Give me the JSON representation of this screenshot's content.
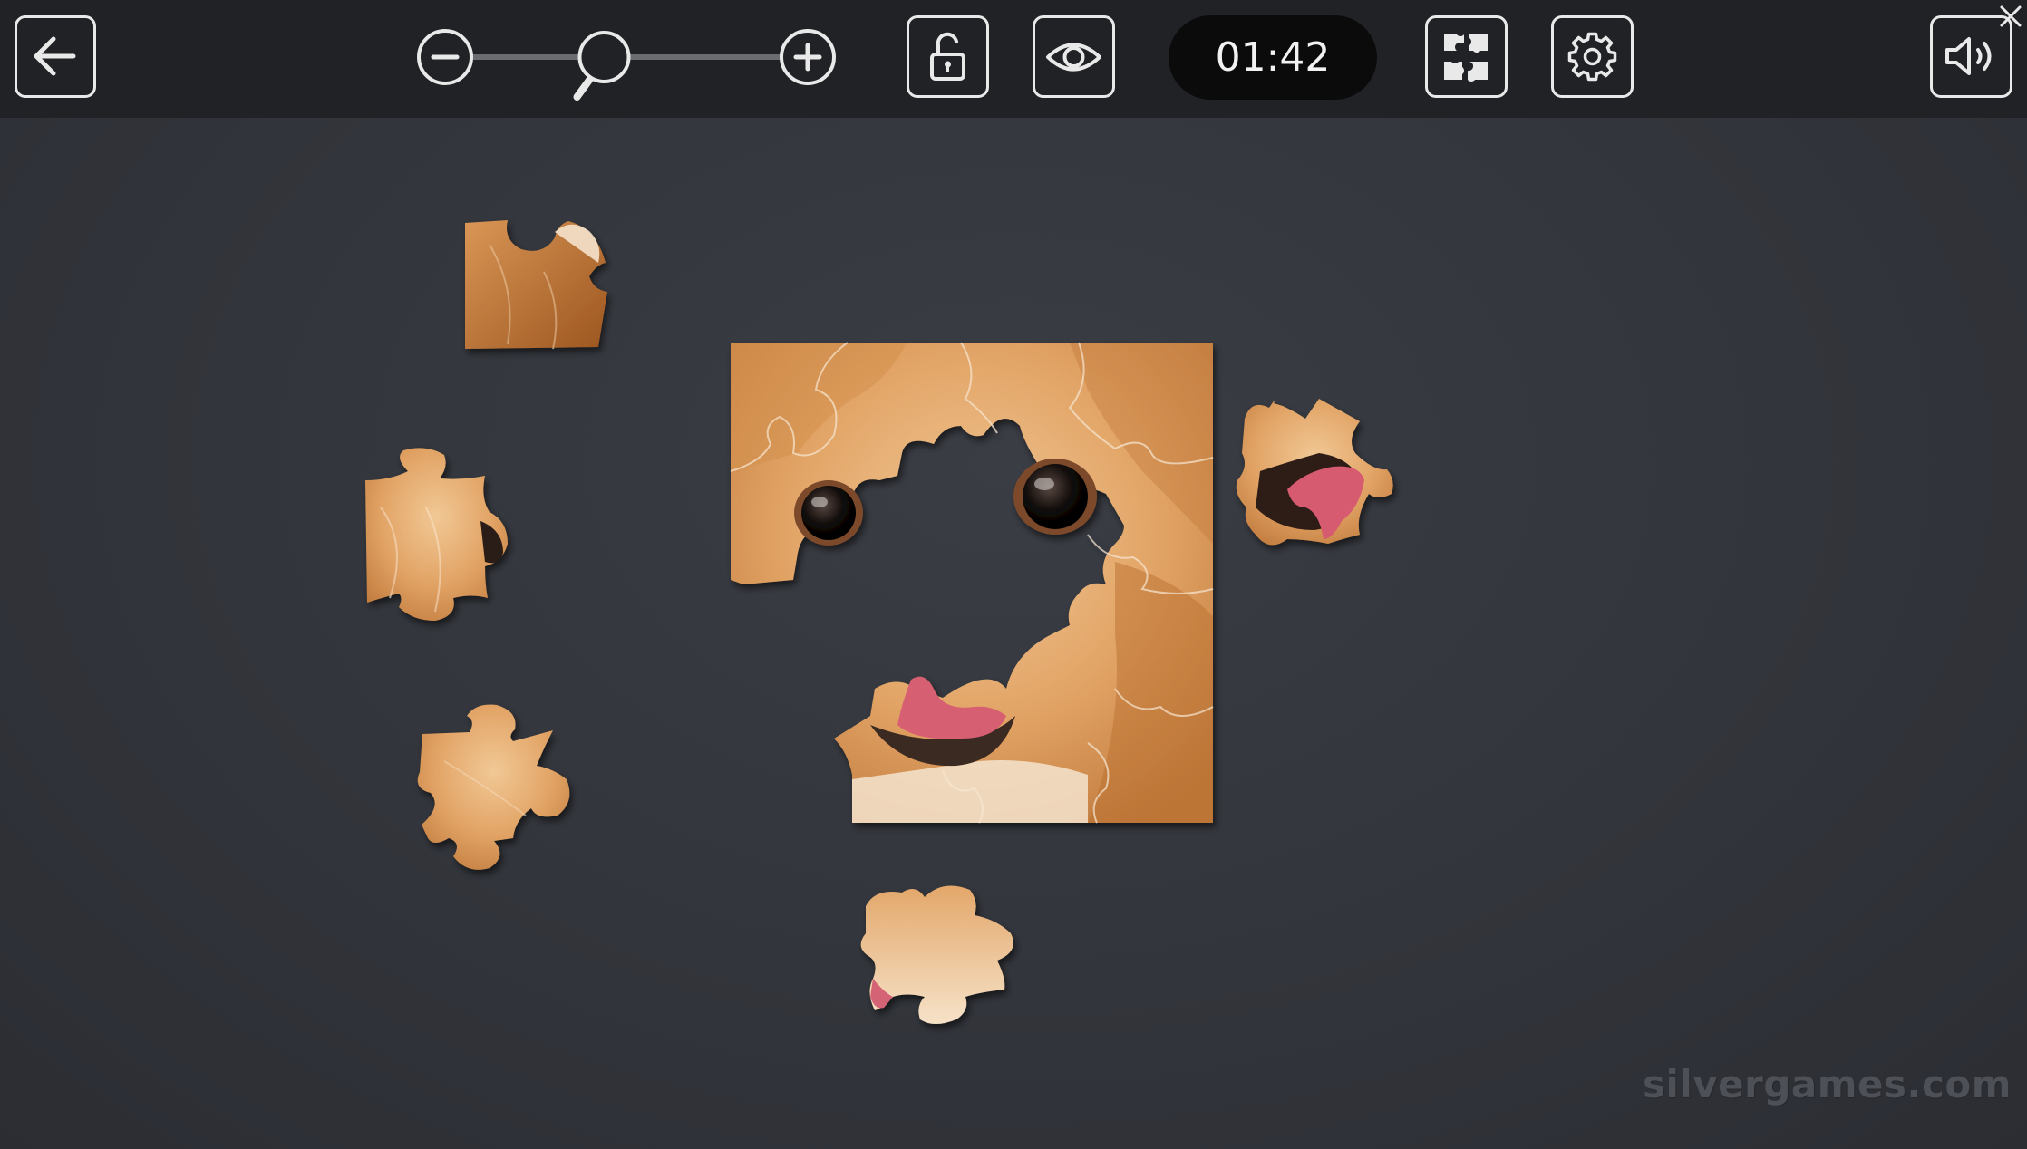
{
  "toolbar": {
    "timer": "01:42",
    "zoom_level": 0.43,
    "icons": {
      "back": "arrow-left-icon",
      "zoom_out": "minus-circle-icon",
      "zoom_in": "plus-circle-icon",
      "zoom_handle": "magnifier-icon",
      "lock": "unlocked-padlock-icon",
      "preview": "eye-icon",
      "edges": "puzzle-pieces-icon",
      "settings": "gear-icon",
      "sound": "speaker-icon",
      "close": "close-icon"
    }
  },
  "board": {
    "image_subject": "pomeranian dog face",
    "assembled_area": "partial",
    "loose_piece_count": 5
  },
  "watermark": "silvergames.com",
  "colors": {
    "toolbar_bg": "#202226",
    "board_bg": "#32353b",
    "icon_stroke": "#e9e9e9",
    "timer_bg": "#0b0b0c",
    "fur_light": "#e8b27a",
    "fur_dark": "#b86b2e"
  }
}
